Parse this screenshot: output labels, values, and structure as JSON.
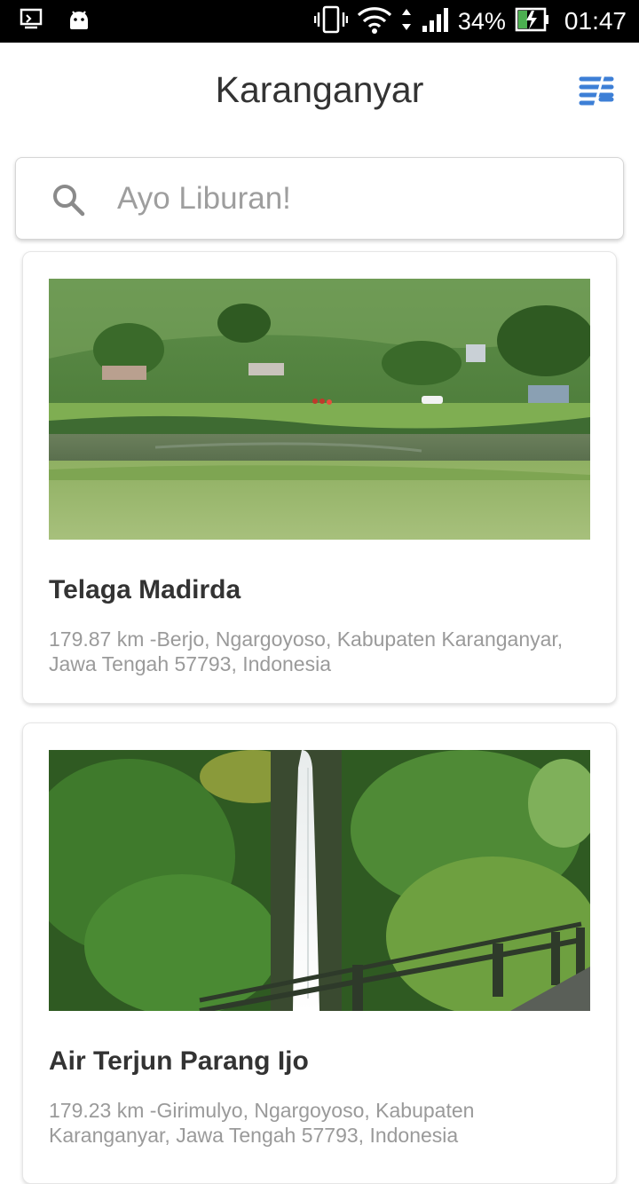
{
  "status_bar": {
    "battery_percent": "34%",
    "time": "01:47"
  },
  "app_bar": {
    "title": "Karanganyar"
  },
  "search": {
    "placeholder": "Ayo Liburan!"
  },
  "places": [
    {
      "name": "Telaga Madirda",
      "distance_address": "179.87 km -Berjo, Ngargoyoso, Kabupaten Karanganyar, Jawa Tengah 57793, Indonesia"
    },
    {
      "name": "Air Terjun Parang Ijo",
      "distance_address": "179.23 km -Girimulyo, Ngargoyoso, Kabupaten Karanganyar, Jawa Tengah 57793, Indonesia"
    }
  ],
  "colors": {
    "status_bar_bg": "#000000",
    "filter_icon": "#3d7fd6",
    "title_text": "#333333",
    "secondary_text": "#9a9a9a"
  }
}
